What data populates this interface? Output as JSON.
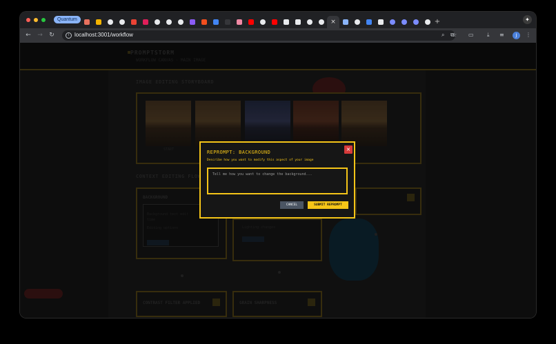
{
  "browser": {
    "tab_group_label": "Quantum",
    "url": "localhost:3001/workflow",
    "active_tab_close": "×",
    "new_tab": "+",
    "tab_favicons": [
      {
        "icon": "s-badge-icon",
        "color": "#e8715e"
      },
      {
        "icon": "c-badge-icon",
        "color": "#f4b400"
      },
      {
        "icon": "github-icon",
        "color": "#e8eaed"
      },
      {
        "icon": "openai-icon",
        "color": "#e8eaed"
      },
      {
        "icon": "gmail-icon",
        "color": "#ea4335"
      },
      {
        "icon": "slack-icon",
        "color": "#e01e5a"
      },
      {
        "icon": "block-icon",
        "color": "#e8eaed"
      },
      {
        "icon": "chatgpt-icon",
        "color": "#e8eaed"
      },
      {
        "icon": "github-icon",
        "color": "#e8eaed"
      },
      {
        "icon": "v-icon",
        "color": "#8b5cf6"
      },
      {
        "icon": "figma-icon",
        "color": "#f24e1e"
      },
      {
        "icon": "d-icon",
        "color": "#4285f4"
      },
      {
        "icon": "blank-icon",
        "color": "#35363a"
      },
      {
        "icon": "notion-icon",
        "color": "#f08aa5"
      },
      {
        "icon": "youtube-icon",
        "color": "#ff0000"
      },
      {
        "icon": "google-icon",
        "color": "#e8eaed"
      },
      {
        "icon": "youtube-icon",
        "color": "#ff0000"
      },
      {
        "icon": "d-icon",
        "color": "#e8eaed"
      },
      {
        "icon": "code-icon",
        "color": "#e8eaed"
      },
      {
        "icon": "openai-icon",
        "color": "#e8eaed"
      },
      {
        "icon": "openai-icon",
        "color": "#e8eaed"
      }
    ],
    "tab_favicons_after": [
      {
        "icon": "sparkle-icon",
        "color": "#8ab4f8"
      },
      {
        "icon": "openai-icon",
        "color": "#e8eaed"
      },
      {
        "icon": "square-icon",
        "color": "#4285f4"
      },
      {
        "icon": "calendar-icon",
        "color": "#e8eaed"
      },
      {
        "icon": "gear-icon",
        "color": "#7b8cff"
      },
      {
        "icon": "gear-icon",
        "color": "#7b8cff"
      },
      {
        "icon": "gear-icon",
        "color": "#7b8cff"
      },
      {
        "icon": "openai-icon",
        "color": "#e8eaed"
      }
    ],
    "profile_initial": "J"
  },
  "page": {
    "brand": "PROMPTSTORM",
    "subtitle": "WORKFLOW CANVAS · MAIN IMAGE",
    "gallery_label": "IMAGE EDITING STORYBOARD",
    "flow_label": "CONTEXT EDITING FLOW",
    "thumb_caption": "START",
    "cards": {
      "background_title": "BACKGROUND",
      "background_line1": "Background text edit",
      "background_line2": "time",
      "background_line3": "Editing options",
      "background_btn": "REPROMPT",
      "second_line": "Lighting changes",
      "second_btn": "REPROMPT",
      "filter_title": "CONTRAST FILTER APPLIED",
      "grain_title": "GRAIN SHARPNESS"
    }
  },
  "modal": {
    "title": "REPROMPT: BACKGROUND",
    "subtitle": "Describe how you want to modify this aspect of your image",
    "close_label": "×",
    "textarea_placeholder": "Tell me how you want to change the background...",
    "cancel_label": "CANCEL",
    "submit_label": "SUBMIT REPROMPT",
    "accent_color": "#f5c518",
    "close_color": "#d63a3a"
  }
}
